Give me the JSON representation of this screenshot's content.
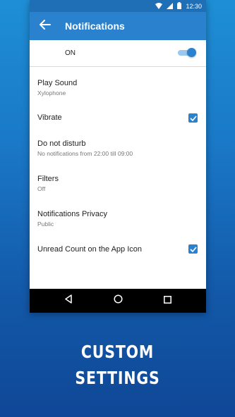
{
  "statusbar": {
    "time": "12:30"
  },
  "appbar": {
    "title": "Notifications"
  },
  "master_toggle": {
    "label": "ON",
    "state": "on"
  },
  "settings": [
    {
      "title": "Play Sound",
      "subtitle": "Xylophone"
    },
    {
      "title": "Vibrate",
      "checked": true
    },
    {
      "title": "Do not disturb",
      "subtitle": "No notifications from 22:00 till 09:00"
    },
    {
      "title": "Filters",
      "subtitle": "Off"
    },
    {
      "title": "Notifications Privacy",
      "subtitle": "Public"
    },
    {
      "title": "Unread Count on the App Icon",
      "checked": true
    }
  ],
  "tagline": {
    "line1": "CUSTOM",
    "line2": "SETTINGS"
  },
  "colors": {
    "accent": "#2a82cf",
    "statusbar": "#1f6fb6",
    "background_top": "#1e8fd6",
    "background_bottom": "#0f4796"
  },
  "icons": [
    "wifi-icon",
    "signal-icon",
    "battery-icon",
    "back-arrow-icon",
    "checkbox-checked-icon",
    "nav-back-icon",
    "nav-home-icon",
    "nav-recents-icon"
  ]
}
